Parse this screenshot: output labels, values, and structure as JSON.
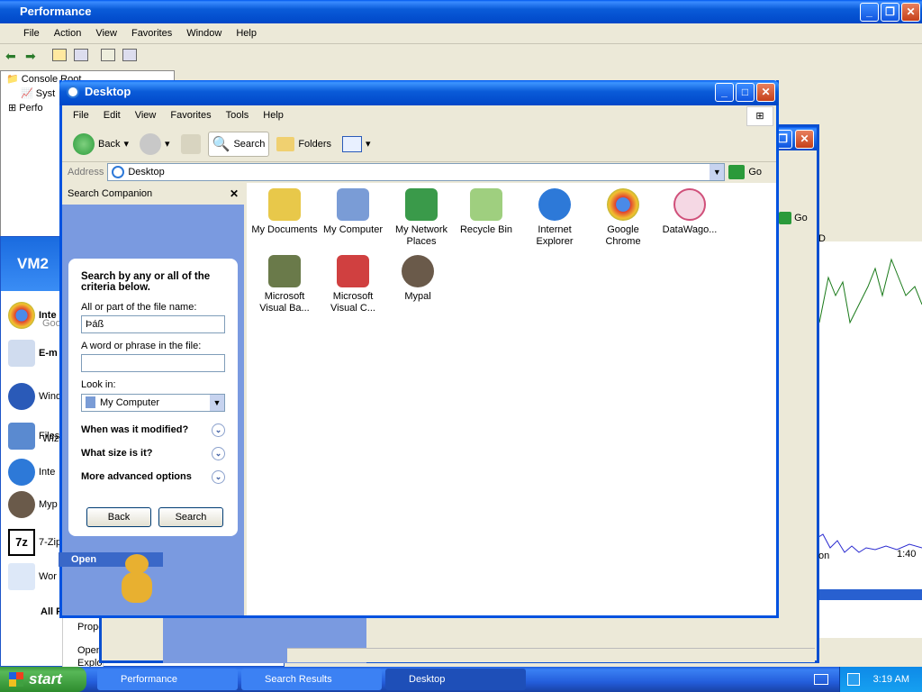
{
  "performance": {
    "title": "Performance",
    "menu": [
      "File",
      "Action",
      "View",
      "Favorites",
      "Window",
      "Help"
    ],
    "tree": [
      "Console Root",
      "Syst",
      "Perfo"
    ],
    "chart_time": "1:40"
  },
  "start_menu": {
    "user": "VM2",
    "items": [
      "Inte",
      "Goo",
      "E-m",
      "Wind",
      "Files",
      "Wiza",
      "Inte",
      "Myp",
      "7-Zip",
      "Wor",
      "All P"
    ],
    "context_items": [
      "Prope",
      "Open",
      "Explo"
    ]
  },
  "search_results": {
    "go_label": "Go",
    "col_header": "D",
    "status_label": "on"
  },
  "desktop_window": {
    "title": "Desktop",
    "menu": [
      "File",
      "Edit",
      "View",
      "Favorites",
      "Tools",
      "Help"
    ],
    "toolbar": {
      "back": "Back",
      "search": "Search",
      "folders": "Folders"
    },
    "address_label": "Address",
    "address_value": "Desktop",
    "go_label": "Go",
    "companion": {
      "header": "Search Companion",
      "intro": "Search by any or all of the criteria below.",
      "filename_label": "All or part of the file name:",
      "filename_value": "Þáß",
      "phrase_label": "A word or phrase in the file:",
      "phrase_value": "",
      "lookin_label": "Look in:",
      "lookin_value": "My Computer",
      "opt1": "When was it modified?",
      "opt2": "What size is it?",
      "opt3": "More advanced options",
      "back_btn": "Back",
      "search_btn": "Search",
      "open_label": "Open"
    },
    "files": [
      {
        "l1": "My Documents",
        "l2": "",
        "color": "#e8c84a"
      },
      {
        "l1": "My Computer",
        "l2": "",
        "color": "#7a9cd6"
      },
      {
        "l1": "My Network",
        "l2": "Places",
        "color": "#3a9a4a"
      },
      {
        "l1": "Recycle Bin",
        "l2": "",
        "color": "#9fcf7f"
      },
      {
        "l1": "Internet",
        "l2": "Explorer",
        "color": "#2d79d8"
      },
      {
        "l1": "Google",
        "l2": "Chrome",
        "color": "#e04a3a"
      },
      {
        "l1": "DataWago...",
        "l2": "",
        "color": "#d0507a"
      },
      {
        "l1": "Microsoft",
        "l2": "Visual Ba...",
        "color": "#6a7a4a"
      },
      {
        "l1": "Microsoft",
        "l2": "Visual C...",
        "color": "#d04040"
      },
      {
        "l1": "Mypal",
        "l2": "",
        "color": "#6a5a4a"
      }
    ]
  },
  "taskbar": {
    "start": "start",
    "tasks": [
      "Performance",
      "Search Results",
      "Desktop"
    ],
    "clock": "3:19 AM"
  }
}
